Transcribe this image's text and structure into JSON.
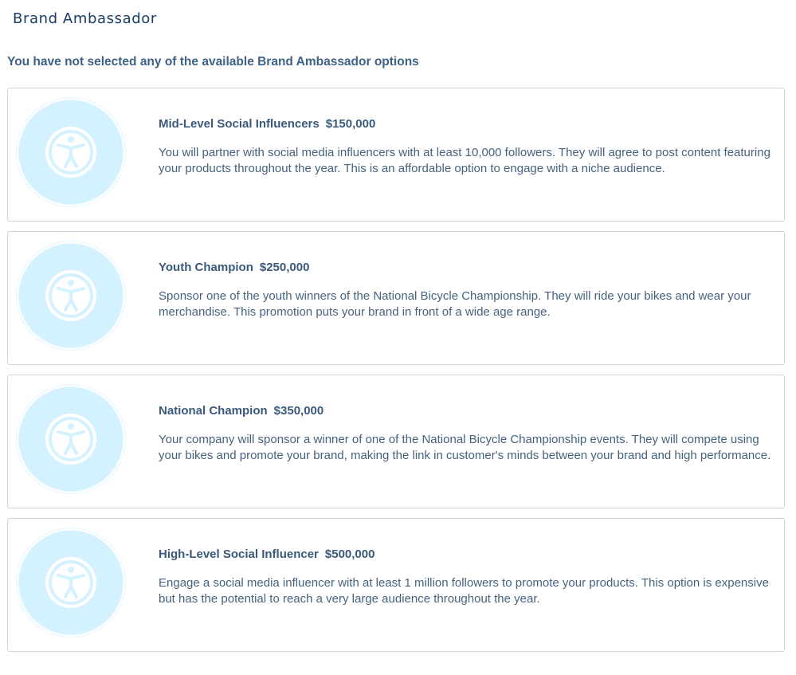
{
  "header": {
    "title": "Brand Ambassador"
  },
  "status": {
    "text": "You have not selected any of the available Brand Ambassador options"
  },
  "options": [
    {
      "title": "Mid-Level Social Influencers",
      "price": "$150,000",
      "description": "You will partner with social media influencers with at least 10,000 followers. They will agree to post content featuring your products throughout the year. This is an affordable option to engage with a niche audience.",
      "icon": "accessibility-icon"
    },
    {
      "title": "Youth Champion",
      "price": "$250,000",
      "description": "Sponsor one of the youth winners of the National Bicycle Championship. They will ride your bikes and wear your merchandise. This promotion puts your brand in front of a wide age range.",
      "icon": "accessibility-icon"
    },
    {
      "title": "National Champion",
      "price": "$350,000",
      "description": "Your company will sponsor a winner of one of the National Bicycle Championship events. They will compete using your bikes and promote your brand, making the link in customer's minds between your brand and high performance.",
      "icon": "accessibility-icon"
    },
    {
      "title": "High-Level Social Influencer",
      "price": "$500,000",
      "description": "Engage a social media influencer with at least 1 million followers to promote your products. This option is expensive but has the potential to reach a very large audience throughout the year.",
      "icon": "accessibility-icon"
    }
  ],
  "colors": {
    "title": "#1a3d68",
    "text": "#3d6187",
    "icon_circle": "#d4f1ff",
    "card_border": "#cfd4d9"
  }
}
